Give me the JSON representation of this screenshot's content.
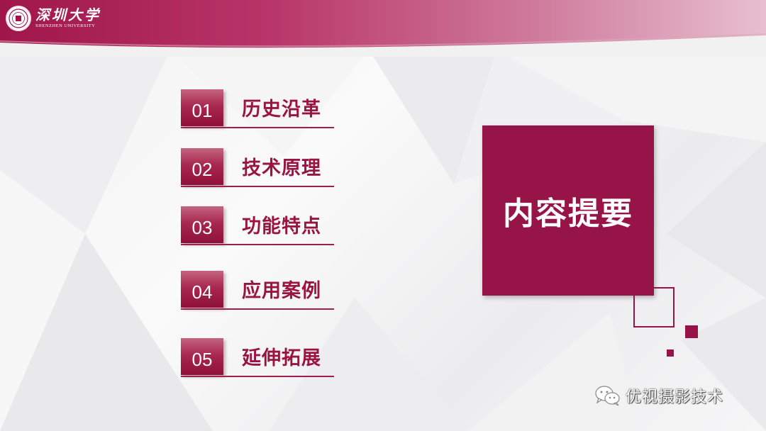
{
  "header": {
    "logo_cn": "深圳大学",
    "logo_en": "SHENZHEN UNIVERSITY"
  },
  "menu": [
    {
      "num": "01",
      "label": "历史沿革"
    },
    {
      "num": "02",
      "label": "技术原理"
    },
    {
      "num": "03",
      "label": "功能特点"
    },
    {
      "num": "04",
      "label": "应用案例"
    },
    {
      "num": "05",
      "label": "延伸拓展"
    }
  ],
  "title": "内容提要",
  "watermark": {
    "icon": "wechat-icon",
    "text": "优视摄影技术"
  },
  "colors": {
    "accent": "#961447",
    "header_start": "#a0164a",
    "header_end": "#e7bfcf"
  }
}
